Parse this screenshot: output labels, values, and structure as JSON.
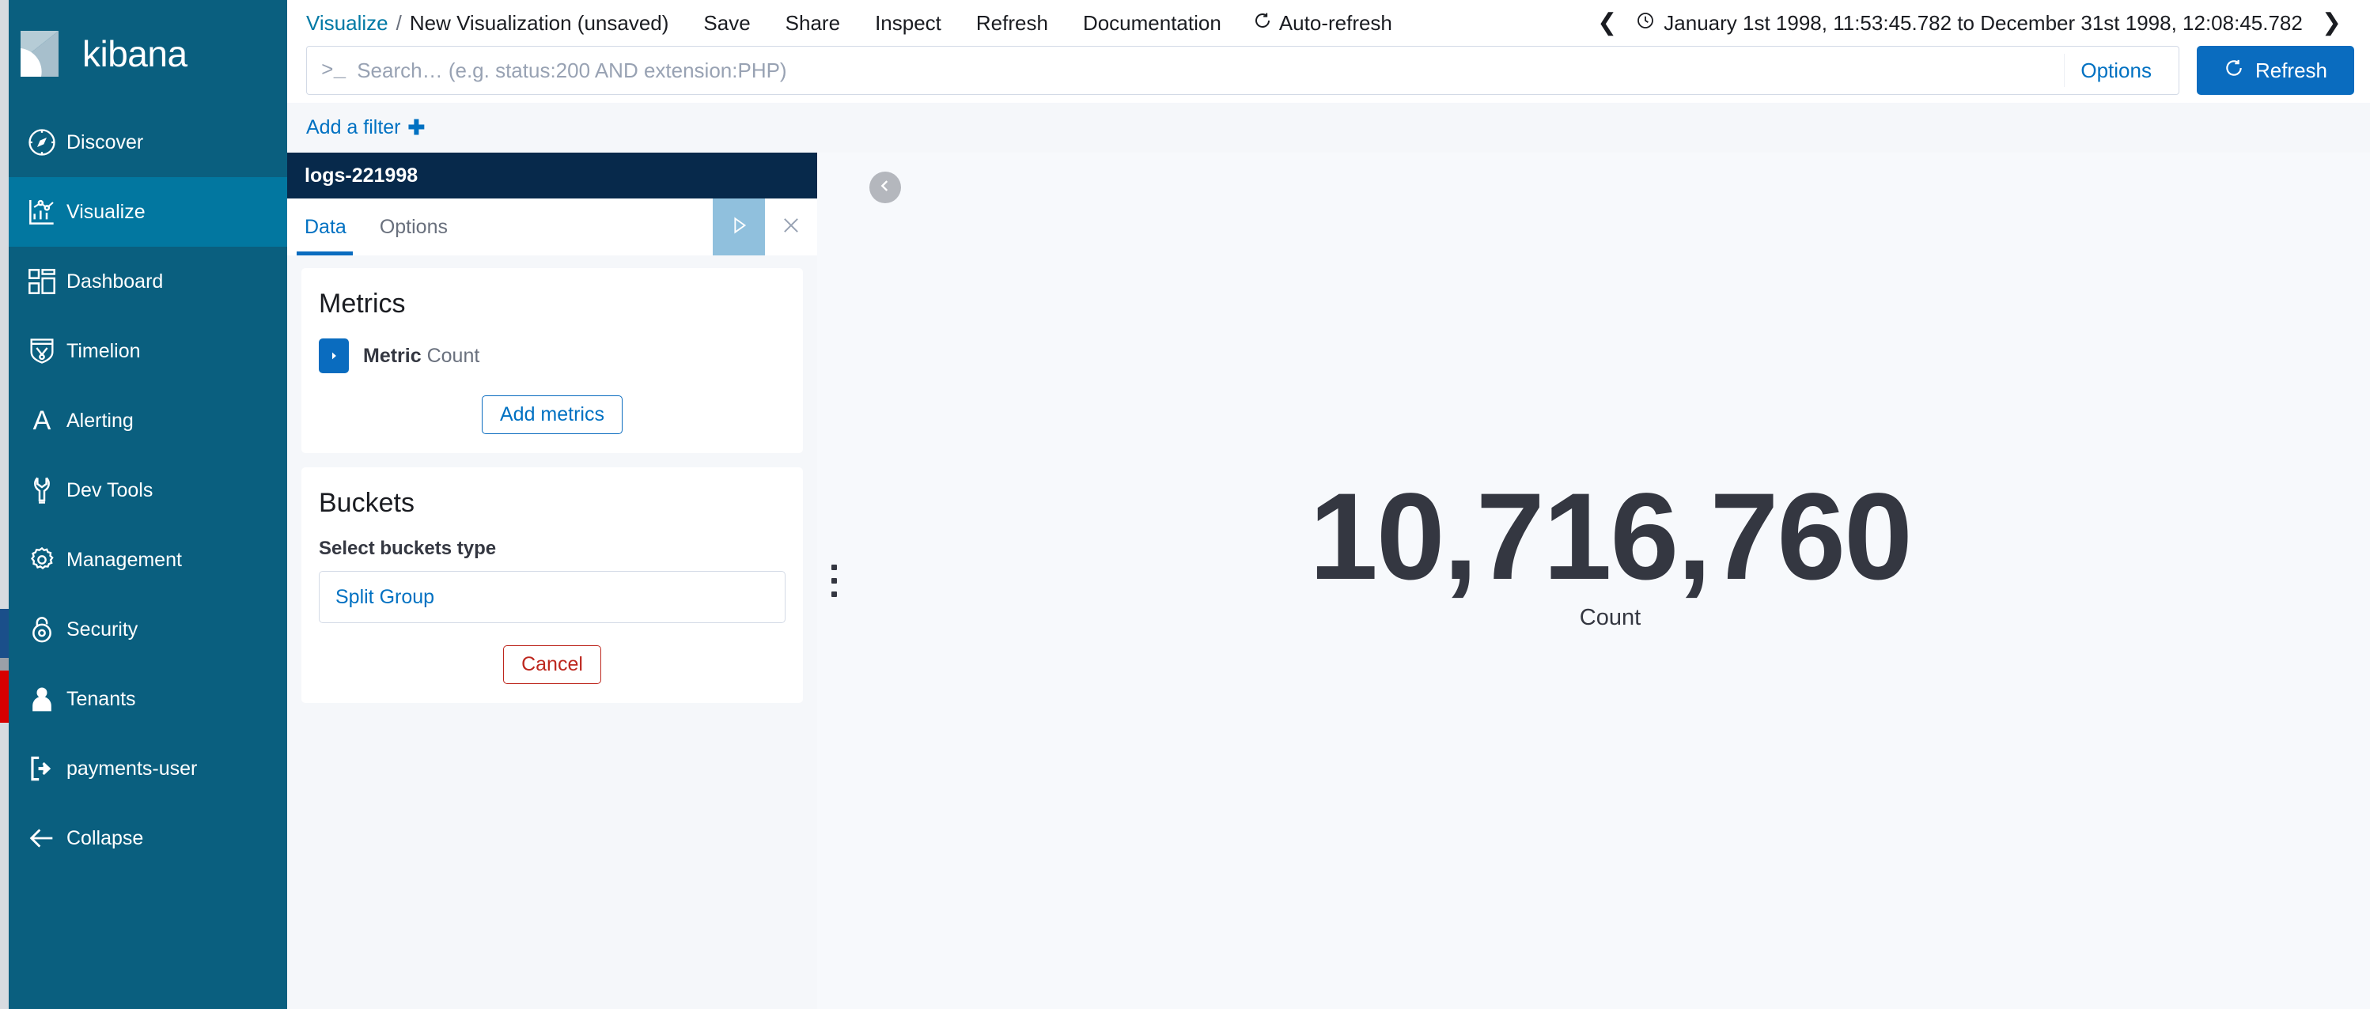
{
  "sidebar": {
    "brand": "kibana",
    "items": [
      {
        "label": "Discover",
        "icon": "compass-icon",
        "active": false
      },
      {
        "label": "Visualize",
        "icon": "visualize-chart-icon",
        "active": true
      },
      {
        "label": "Dashboard",
        "icon": "dashboard-grid-icon",
        "active": false
      },
      {
        "label": "Timelion",
        "icon": "timelion-shield-icon",
        "active": false
      },
      {
        "label": "Alerting",
        "icon": "letter-a-icon",
        "active": false
      },
      {
        "label": "Dev Tools",
        "icon": "wrench-icon",
        "active": false
      },
      {
        "label": "Management",
        "icon": "gear-icon",
        "active": false
      },
      {
        "label": "Security",
        "icon": "lock-icon",
        "active": false
      },
      {
        "label": "Tenants",
        "icon": "user-icon",
        "active": false
      }
    ],
    "bottom": [
      {
        "label": "payments-user",
        "icon": "logout-icon"
      },
      {
        "label": "Collapse",
        "icon": "arrow-left-icon"
      }
    ]
  },
  "topbar": {
    "breadcrumb_link": "Visualize",
    "breadcrumb_separator": "/",
    "breadcrumb_current": "New Visualization (unsaved)",
    "actions": [
      "Save",
      "Share",
      "Inspect",
      "Refresh",
      "Documentation"
    ],
    "auto_refresh": "Auto-refresh",
    "auto_refresh_icon": "refresh-cycle-icon",
    "prev_icon": "chevron-left-icon",
    "next_icon": "chevron-right-icon",
    "clock_icon": "clock-icon",
    "time_range": "January 1st 1998, 11:53:45.782 to December 31st 1998, 12:08:45.782"
  },
  "query": {
    "prompt_icon": ">_",
    "placeholder": "Search… (e.g. status:200 AND extension:PHP)",
    "value": "",
    "options_label": "Options",
    "refresh_label": "Refresh",
    "refresh_icon": "refresh-cycle-icon"
  },
  "filters": {
    "add_filter_label": "Add a filter",
    "add_filter_icon": "plus-icon"
  },
  "editor": {
    "index_title": "logs-221998",
    "tabs": [
      {
        "label": "Data",
        "active": true
      },
      {
        "label": "Options",
        "active": false
      }
    ],
    "apply_icon": "play-triangle-icon",
    "close_icon": "close-x-icon",
    "metrics": {
      "heading": "Metrics",
      "toggle_icon": "caret-right-icon",
      "agg_name": "Metric",
      "agg_value": "Count",
      "add_label": "Add metrics"
    },
    "buckets": {
      "heading": "Buckets",
      "select_label": "Select buckets type",
      "option": "Split Group",
      "cancel_label": "Cancel"
    }
  },
  "visualization": {
    "collapse_icon": "chevron-left-circle-icon",
    "drag_handle_icon": "vertical-dots-icon",
    "metric_value": "10,716,760",
    "metric_label": "Count"
  },
  "colors": {
    "sidebar_bg": "#0a5f7f",
    "sidebar_active": "#0277a0",
    "editor_header": "#07294b",
    "link": "#0071c2",
    "primary_button": "#0a6cbf",
    "danger": "#bd271e",
    "canvas": "#f7f9fc",
    "metric_text": "#343741"
  }
}
